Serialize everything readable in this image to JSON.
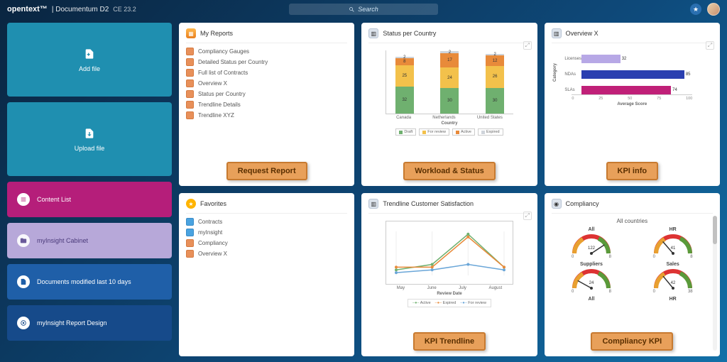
{
  "header": {
    "brand": "opentext™",
    "product": "Documentum D2",
    "version": "CE 23.2",
    "search_placeholder": "Search"
  },
  "sidebar": {
    "add_file": "Add file",
    "upload_file": "Upload file",
    "items": [
      {
        "label": "Content List"
      },
      {
        "label": "myInsight Cabinet"
      },
      {
        "label": "Documents modified last 10 days"
      },
      {
        "label": "myInsight Report Design"
      }
    ]
  },
  "colors": {
    "draft": "#6fb06f",
    "review": "#f3c14b",
    "active": "#e88a3a",
    "expired": "#cfd4db",
    "licenses": "#b7a8e6",
    "ndas": "#2a3fb0",
    "slas": "#c02078",
    "line_active": "#6fb06f",
    "line_expired": "#e88a3a",
    "line_review": "#6aa6d8"
  },
  "tiles": {
    "my_reports": {
      "title": "My Reports",
      "items": [
        "Compliancy Gauges",
        "Detailed Status per Country",
        "Full list of Contracts",
        "Overview X",
        "Status per Country",
        "Trendline Details",
        "Trendline XYZ"
      ],
      "annotation": "Request Report"
    },
    "status_country": {
      "title": "Status per Country",
      "annotation": "Workload & Status",
      "xlabel": "Country",
      "legend": [
        "Draft",
        "For review",
        "Active",
        "Expired"
      ]
    },
    "overview_x": {
      "title": "Overview X",
      "annotation": "KPI info",
      "ylabel": "Category",
      "xlabel": "Average Score"
    },
    "favorites": {
      "title": "Favorites",
      "items": [
        "Contracts",
        "myInsight",
        "Compliancy",
        "Overview X"
      ]
    },
    "trendline": {
      "title": "Trendline Customer Satisfaction",
      "annotation": "KPI Trendline",
      "xlabel": "Review Date",
      "legend": [
        "Active",
        "Expired",
        "For review"
      ]
    },
    "compliancy": {
      "title": "Compliancy",
      "subtitle": "All countries",
      "annotation": "Compliancy KPI"
    }
  },
  "chart_data": [
    {
      "id": "status_per_country",
      "type": "bar_stacked",
      "xlabel": "Country",
      "categories": [
        "Canada",
        "Netherlands",
        "United States"
      ],
      "series": [
        {
          "name": "Draft",
          "values": [
            32,
            30,
            30
          ],
          "color": "#6fb06f"
        },
        {
          "name": "For review",
          "values": [
            25,
            24,
            26
          ],
          "color": "#f3c14b"
        },
        {
          "name": "Active",
          "values": [
            8,
            17,
            12
          ],
          "color": "#e88a3a"
        },
        {
          "name": "Expired",
          "values": [
            2,
            2,
            2
          ],
          "color": "#cfd4db"
        }
      ],
      "ylim": [
        0,
        70
      ]
    },
    {
      "id": "overview_x",
      "type": "bar_horizontal",
      "ylabel": "Category",
      "xlabel": "Average Score",
      "xlim": [
        0,
        100
      ],
      "ticks": [
        0,
        25,
        50,
        75,
        100
      ],
      "categories": [
        "Licenses",
        "NDAs",
        "SLAs"
      ],
      "values": [
        32,
        85,
        74
      ],
      "colors": [
        "#b7a8e6",
        "#2a3fb0",
        "#c02078"
      ]
    },
    {
      "id": "trendline_customer_satisfaction",
      "type": "line",
      "xlabel": "Review Date",
      "x": [
        "May",
        "June",
        "July",
        "August"
      ],
      "ylim": [
        0,
        16
      ],
      "series": [
        {
          "name": "Active",
          "values": [
            2,
            4,
            15,
            3
          ],
          "color": "#6fb06f"
        },
        {
          "name": "Expired",
          "values": [
            3,
            3,
            14,
            3
          ],
          "color": "#e88a3a"
        },
        {
          "name": "For review",
          "values": [
            1,
            2,
            4,
            2
          ],
          "color": "#6aa6d8"
        }
      ]
    },
    {
      "id": "compliancy_gauges",
      "type": "gauge_grid",
      "title": "All countries",
      "range": [
        0,
        150
      ],
      "gauges": [
        {
          "name": "All",
          "value": 122,
          "low": 0,
          "high": 8
        },
        {
          "name": "HR",
          "value": 41,
          "low": 0,
          "high": 8
        },
        {
          "name": "Suppliers",
          "value": 24,
          "low": 0,
          "high": 8
        },
        {
          "name": "Sales",
          "value": 42,
          "low": 0,
          "high": 38
        },
        {
          "name": "All",
          "value": null
        },
        {
          "name": "HR",
          "value": null
        }
      ]
    }
  ]
}
